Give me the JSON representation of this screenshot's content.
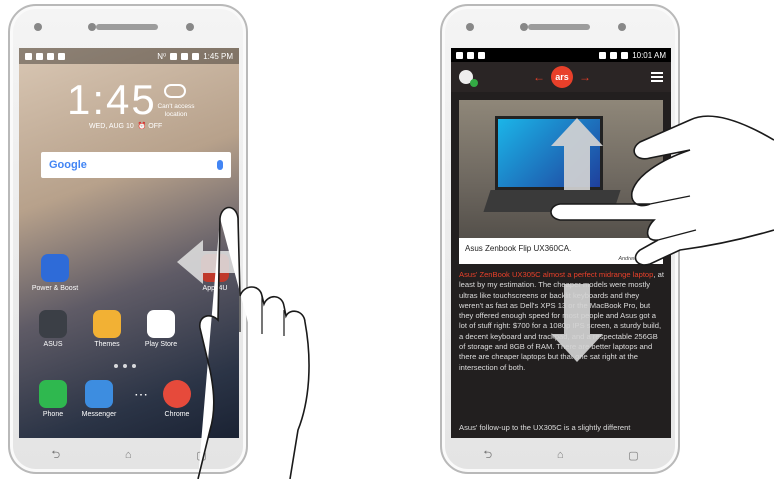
{
  "left_phone": {
    "status": {
      "nfc_label": "N⁰",
      "time": "1:45 PM"
    },
    "lock": {
      "clock": "1:45",
      "date": "WED, AUG 10",
      "alarm": "OFF",
      "weather_text": "Can't access location"
    },
    "search": {
      "logo": "Google"
    },
    "apps": [
      {
        "label": "Power & Boost",
        "color": "#2e6bd8"
      },
      {
        "label": "Apps4U",
        "color": "#c0392b"
      },
      {
        "label": "ASUS",
        "color": "#3b3f46"
      },
      {
        "label": "Themes",
        "color": "#f2b134"
      },
      {
        "label": "Play Store",
        "color": "#ffffff"
      },
      {
        "label": "Phone",
        "color": "#2fb84f"
      },
      {
        "label": "Messenger",
        "color": "#3d8de0"
      },
      {
        "label": "Chrome",
        "color": "#e64a3b"
      }
    ],
    "nav": {
      "back": "⮌",
      "home": "⌂",
      "recents": "▢"
    }
  },
  "right_phone": {
    "status": {
      "time": "10:01 AM"
    },
    "header": {
      "logo": "ars",
      "left_arrow": "←",
      "right_arrow": "→"
    },
    "caption": "Asus Zenbook Flip UX360CA.",
    "credit": "Andrew Cunning",
    "article": {
      "lead_highlight": "Asus' ZenBook UX305C",
      "lead_highlight2": "almost a perfect midrange laptop",
      "body": ", at least by my estimation. The cheaper models were mostly ultras like touchscreens or backlit keyboards and they weren't as fast as Dell's XPS 13 or the MacBook Pro, but they offered enough speed for most people and Asus got a lot of stuff right: $700 for a 1080p IPS screen, a sturdy build, a decent keyboard and trackpad, and a respectable 256GB of storage and 8GB of RAM. There are better laptops and there are cheaper laptops but that one sat right at the intersection of both.",
      "next": "Asus' follow-up to the UX305C is a slightly different"
    },
    "nav": {
      "back": "⮌",
      "home": "⌂",
      "recents": "▢"
    }
  }
}
